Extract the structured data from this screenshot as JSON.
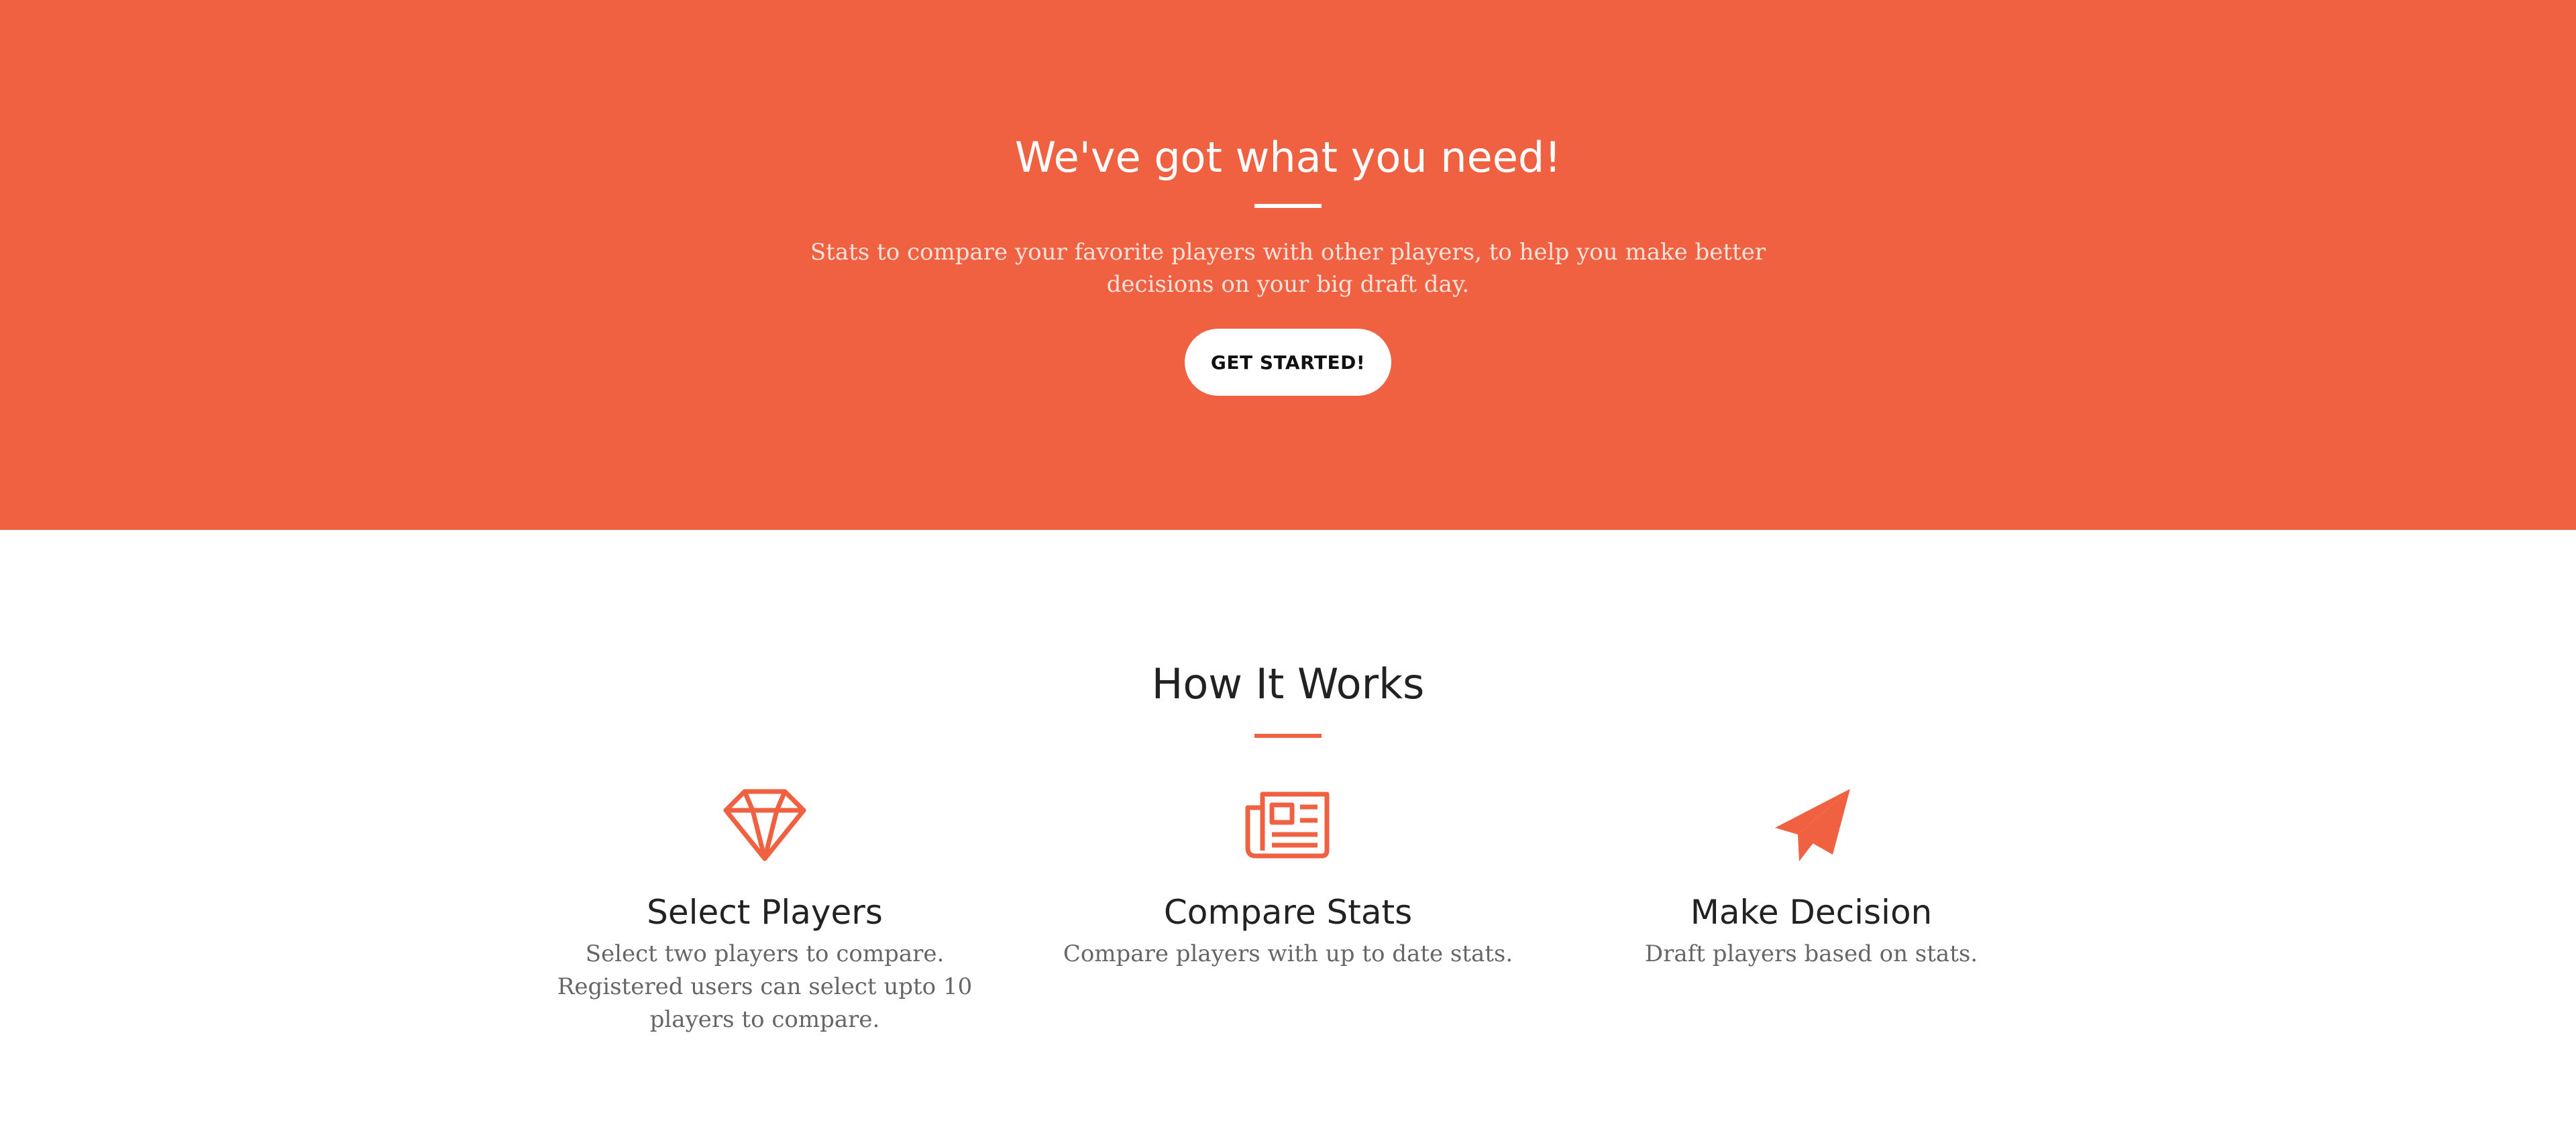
{
  "hero": {
    "title": "We've got what you need!",
    "text": "Stats to compare your favorite players with other players, to help you make better decisions on your big draft day.",
    "button_label": "GET STARTED!"
  },
  "how_it_works": {
    "title": "How It Works",
    "features": [
      {
        "icon": "diamond-icon",
        "title": "Select Players",
        "text": "Select two players to compare. Registered users can select upto 10 players to compare."
      },
      {
        "icon": "newspaper-icon",
        "title": "Compare Stats",
        "text": "Compare players with up to date stats."
      },
      {
        "icon": "paper-plane-icon",
        "title": "Make Decision",
        "text": "Draft players based on stats."
      }
    ]
  },
  "colors": {
    "accent": "#f06142",
    "hero_background": "#f06142",
    "button_background": "#ffffff",
    "heading_text": "#222222",
    "body_text": "#666666"
  }
}
